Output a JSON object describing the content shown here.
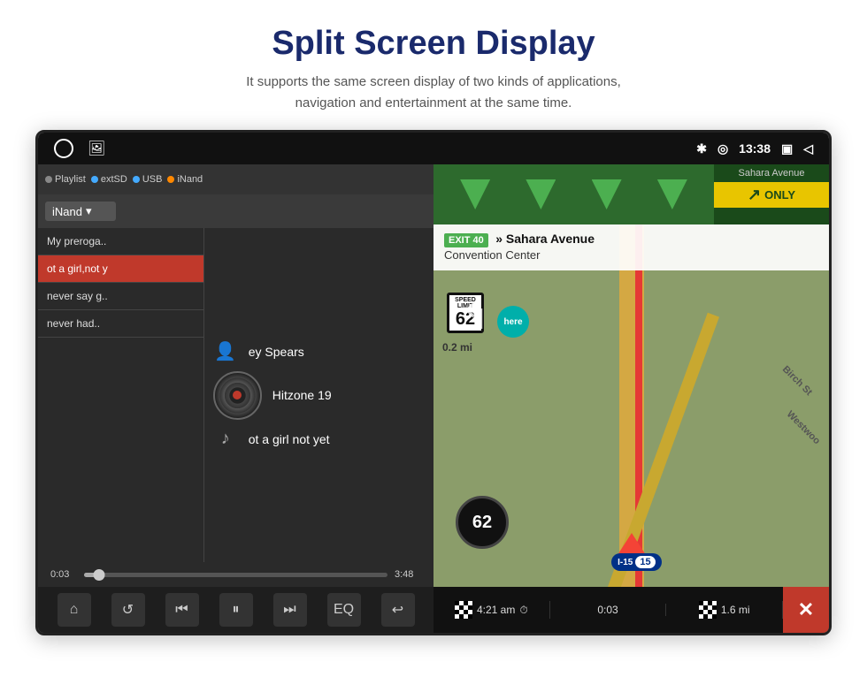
{
  "header": {
    "title": "Split Screen Display",
    "subtitle": "It supports the same screen display of two kinds of applications,\nnavigation and entertainment at the same time."
  },
  "status_bar": {
    "time": "13:38",
    "bluetooth_icon": "bluetooth-icon",
    "location_icon": "location-icon",
    "window_icon": "window-icon",
    "back_icon": "back-icon"
  },
  "music_panel": {
    "source_label": "iNand",
    "tabs": [
      {
        "label": "Playlist",
        "dot_color": "gray"
      },
      {
        "label": "extSD",
        "dot_color": "blue"
      },
      {
        "label": "USB",
        "dot_color": "blue"
      },
      {
        "label": "iNand",
        "dot_color": "orange"
      }
    ],
    "playlist": [
      {
        "title": "My preroga..",
        "active": false
      },
      {
        "title": "ot a girl,not y",
        "active": true
      },
      {
        "title": "never say g..",
        "active": false
      },
      {
        "title": "never had..",
        "active": false
      }
    ],
    "now_playing": {
      "artist": "ey Spears",
      "album": "Hitzone 19",
      "track": "ot a girl not yet"
    },
    "progress": {
      "current": "0:03",
      "total": "3:48",
      "percent": 5
    },
    "controls": {
      "home": "🏠",
      "repeat": "🔁",
      "prev": "⏮",
      "pause": "⏸",
      "next": "⏭",
      "eq": "EQ",
      "back": "↩"
    }
  },
  "nav_panel": {
    "exit_number": "EXIT 40",
    "street_name": "Sahara Avenue",
    "venue": "Convention Center",
    "only_label": "ONLY",
    "distance_to_turn": "0.2 mi",
    "speed_limit": "62",
    "interstate": "I-15",
    "interstate_number": "15",
    "route_distance": "1.6 mi",
    "eta": "4:21 am",
    "elapsed": "0:03",
    "birch_st": "Birch St",
    "westwood": "Westwoo"
  }
}
